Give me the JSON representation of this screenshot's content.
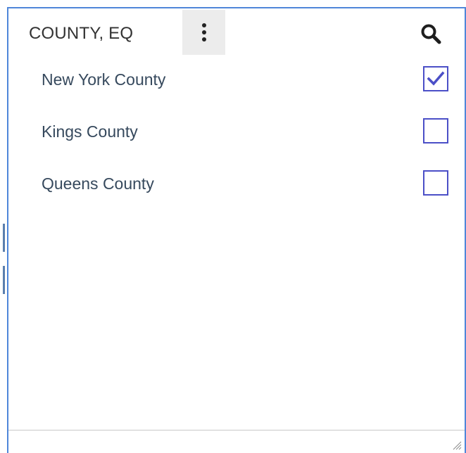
{
  "filter_panel": {
    "title": "COUNTY, EQ",
    "menu_icon": "vertical-ellipsis-icon",
    "search_icon": "search-icon",
    "accent_color": "#4f86d9",
    "checkbox_color": "#4b4fc7",
    "items": [
      {
        "label": "New York County",
        "checked": true
      },
      {
        "label": "Kings County",
        "checked": false
      },
      {
        "label": "Queens County",
        "checked": false
      }
    ]
  }
}
